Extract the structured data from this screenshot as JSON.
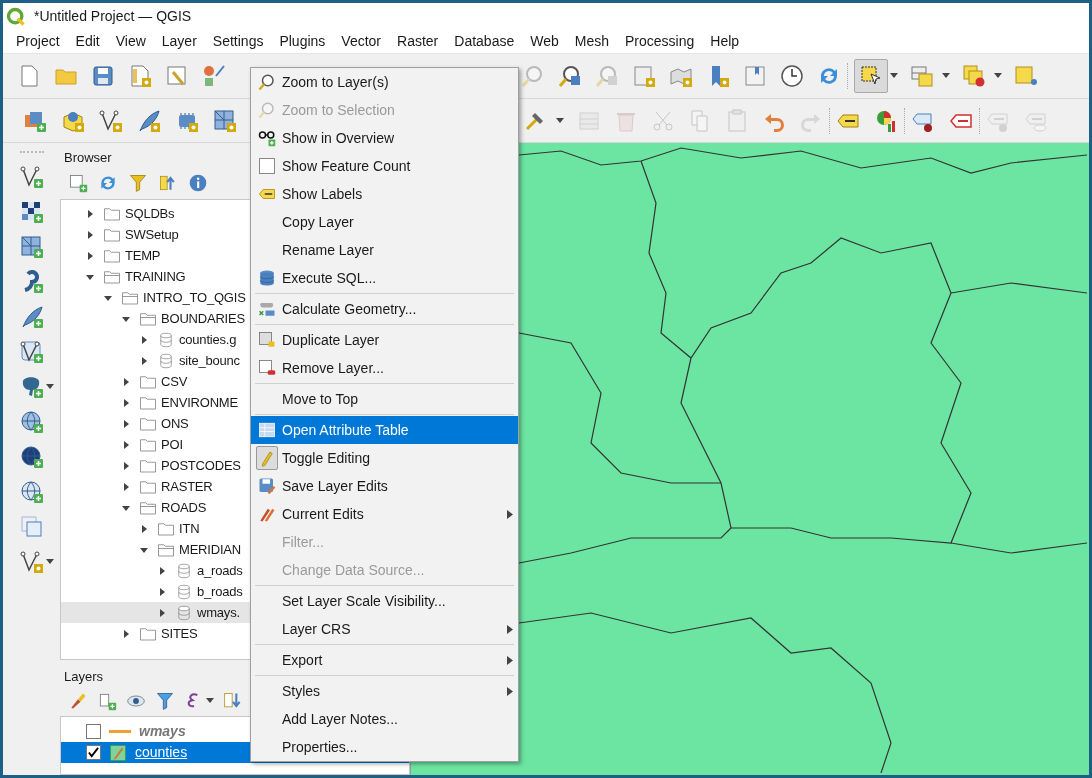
{
  "window": {
    "title": "*Untitled Project — QGIS"
  },
  "menubar": [
    "Project",
    "Edit",
    "View",
    "Layer",
    "Settings",
    "Plugins",
    "Vector",
    "Raster",
    "Database",
    "Web",
    "Mesh",
    "Processing",
    "Help"
  ],
  "browser": {
    "title": "Browser",
    "tree": [
      {
        "label": "SQLDBs",
        "kind": "folder",
        "expanded": false,
        "selected": false
      },
      {
        "label": "SWSetup",
        "kind": "folder",
        "expanded": false,
        "selected": false
      },
      {
        "label": "TEMP",
        "kind": "folder",
        "expanded": false,
        "selected": false
      },
      {
        "label": "TRAINING",
        "kind": "folder",
        "expanded": true,
        "selected": false,
        "children": [
          {
            "label": "INTRO_TO_QGIS",
            "kind": "folder",
            "expanded": true,
            "selected": false,
            "children": [
              {
                "label": "BOUNDARIES",
                "kind": "folder",
                "expanded": true,
                "selected": false,
                "children": [
                  {
                    "label": "counties.g",
                    "kind": "file",
                    "expanded": false,
                    "selected": false
                  },
                  {
                    "label": "site_bounc",
                    "kind": "file",
                    "expanded": false,
                    "selected": false
                  }
                ]
              },
              {
                "label": "CSV",
                "kind": "folder",
                "expanded": false,
                "selected": false
              },
              {
                "label": "ENVIRONME",
                "kind": "folder",
                "expanded": false,
                "selected": false
              },
              {
                "label": "ONS",
                "kind": "folder",
                "expanded": false,
                "selected": false
              },
              {
                "label": "POI",
                "kind": "folder",
                "expanded": false,
                "selected": false
              },
              {
                "label": "POSTCODES",
                "kind": "folder",
                "expanded": false,
                "selected": false
              },
              {
                "label": "RASTER",
                "kind": "folder",
                "expanded": false,
                "selected": false
              },
              {
                "label": "ROADS",
                "kind": "folder",
                "expanded": true,
                "selected": false,
                "children": [
                  {
                    "label": "ITN",
                    "kind": "folder",
                    "expanded": false,
                    "selected": false
                  },
                  {
                    "label": "MERIDIAN",
                    "kind": "folder",
                    "expanded": true,
                    "selected": false,
                    "children": [
                      {
                        "label": "a_roads",
                        "kind": "file",
                        "expanded": false,
                        "selected": false
                      },
                      {
                        "label": "b_roads",
                        "kind": "file",
                        "expanded": false,
                        "selected": false
                      },
                      {
                        "label": "wmays.",
                        "kind": "file",
                        "expanded": false,
                        "selected": true
                      }
                    ]
                  }
                ]
              },
              {
                "label": "SITES",
                "kind": "folder",
                "expanded": false,
                "selected": false
              }
            ]
          }
        ]
      }
    ]
  },
  "layers": {
    "title": "Layers",
    "items": [
      {
        "name": "wmays",
        "kind": "line",
        "visible": false,
        "editing": false,
        "selected": false
      },
      {
        "name": "counties",
        "kind": "polygon",
        "visible": true,
        "editing": true,
        "selected": true
      }
    ]
  },
  "context_menu": {
    "groups": [
      [
        {
          "label": "Zoom to Layer(s)",
          "kind": "action",
          "disabled": false,
          "selected": false,
          "submenu": false
        },
        {
          "label": "Zoom to Selection",
          "kind": "action",
          "disabled": true,
          "selected": false,
          "submenu": false
        },
        {
          "label": "Show in Overview",
          "kind": "action",
          "disabled": false,
          "selected": false,
          "submenu": false
        },
        {
          "label": "Show Feature Count",
          "kind": "checkbox",
          "checked": false,
          "disabled": false,
          "selected": false,
          "submenu": false
        },
        {
          "label": "Show Labels",
          "kind": "action",
          "disabled": false,
          "selected": false,
          "submenu": false
        },
        {
          "label": "Copy Layer",
          "kind": "action",
          "disabled": false,
          "selected": false,
          "submenu": false
        },
        {
          "label": "Rename Layer",
          "kind": "action",
          "disabled": false,
          "selected": false,
          "submenu": false
        },
        {
          "label": "Execute SQL...",
          "kind": "action",
          "disabled": false,
          "selected": false,
          "submenu": false
        }
      ],
      [
        {
          "label": "Calculate Geometry...",
          "kind": "action",
          "disabled": false,
          "selected": false,
          "submenu": false
        }
      ],
      [
        {
          "label": "Duplicate Layer",
          "kind": "action",
          "disabled": false,
          "selected": false,
          "submenu": false
        },
        {
          "label": "Remove Layer...",
          "kind": "action",
          "disabled": false,
          "selected": false,
          "submenu": false
        }
      ],
      [
        {
          "label": "Move to Top",
          "kind": "action",
          "disabled": false,
          "selected": false,
          "submenu": false
        }
      ],
      [
        {
          "label": "Open Attribute Table",
          "kind": "action",
          "disabled": false,
          "selected": true,
          "submenu": false
        },
        {
          "label": "Toggle Editing",
          "kind": "toggle",
          "checked": true,
          "disabled": false,
          "selected": false,
          "submenu": false
        },
        {
          "label": "Save Layer Edits",
          "kind": "action",
          "disabled": false,
          "selected": false,
          "submenu": false
        },
        {
          "label": "Current Edits",
          "kind": "action",
          "disabled": false,
          "selected": false,
          "submenu": true
        },
        {
          "label": "Filter...",
          "kind": "action",
          "disabled": true,
          "selected": false,
          "submenu": false
        },
        {
          "label": "Change Data Source...",
          "kind": "action",
          "disabled": true,
          "selected": false,
          "submenu": false
        }
      ],
      [
        {
          "label": "Set Layer Scale Visibility...",
          "kind": "action",
          "disabled": false,
          "selected": false,
          "submenu": false
        },
        {
          "label": "Layer CRS",
          "kind": "action",
          "disabled": false,
          "selected": false,
          "submenu": true
        }
      ],
      [
        {
          "label": "Export",
          "kind": "action",
          "disabled": false,
          "selected": false,
          "submenu": true
        }
      ],
      [
        {
          "label": "Styles",
          "kind": "action",
          "disabled": false,
          "selected": false,
          "submenu": true
        },
        {
          "label": "Add Layer Notes...",
          "kind": "action",
          "disabled": false,
          "selected": false,
          "submenu": false
        },
        {
          "label": "Properties...",
          "kind": "action",
          "disabled": false,
          "selected": false,
          "submenu": false
        }
      ]
    ]
  }
}
